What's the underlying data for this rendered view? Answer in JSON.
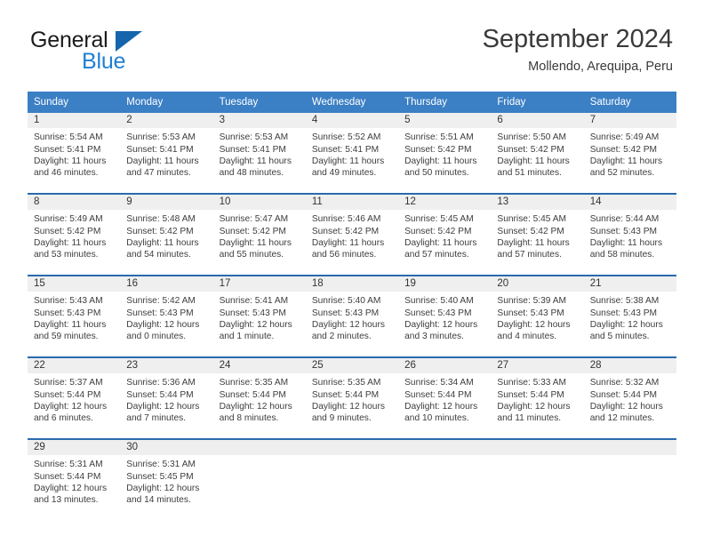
{
  "brand": {
    "name_top": "General",
    "name_bottom": "Blue",
    "triangle_color": "#1565ad",
    "blue_color": "#1f7fd4"
  },
  "header": {
    "title": "September 2024",
    "subtitle": "Mollendo, Arequipa, Peru"
  },
  "theme": {
    "header_bg": "#3b7fc4",
    "week_separator": "#2a6aad",
    "daynum_bg": "#efefef"
  },
  "calendar": {
    "weekdays": [
      "Sunday",
      "Monday",
      "Tuesday",
      "Wednesday",
      "Thursday",
      "Friday",
      "Saturday"
    ],
    "weeks": [
      [
        {
          "day": "1",
          "sunrise": "Sunrise: 5:54 AM",
          "sunset": "Sunset: 5:41 PM",
          "daylight1": "Daylight: 11 hours",
          "daylight2": "and 46 minutes."
        },
        {
          "day": "2",
          "sunrise": "Sunrise: 5:53 AM",
          "sunset": "Sunset: 5:41 PM",
          "daylight1": "Daylight: 11 hours",
          "daylight2": "and 47 minutes."
        },
        {
          "day": "3",
          "sunrise": "Sunrise: 5:53 AM",
          "sunset": "Sunset: 5:41 PM",
          "daylight1": "Daylight: 11 hours",
          "daylight2": "and 48 minutes."
        },
        {
          "day": "4",
          "sunrise": "Sunrise: 5:52 AM",
          "sunset": "Sunset: 5:41 PM",
          "daylight1": "Daylight: 11 hours",
          "daylight2": "and 49 minutes."
        },
        {
          "day": "5",
          "sunrise": "Sunrise: 5:51 AM",
          "sunset": "Sunset: 5:42 PM",
          "daylight1": "Daylight: 11 hours",
          "daylight2": "and 50 minutes."
        },
        {
          "day": "6",
          "sunrise": "Sunrise: 5:50 AM",
          "sunset": "Sunset: 5:42 PM",
          "daylight1": "Daylight: 11 hours",
          "daylight2": "and 51 minutes."
        },
        {
          "day": "7",
          "sunrise": "Sunrise: 5:49 AM",
          "sunset": "Sunset: 5:42 PM",
          "daylight1": "Daylight: 11 hours",
          "daylight2": "and 52 minutes."
        }
      ],
      [
        {
          "day": "8",
          "sunrise": "Sunrise: 5:49 AM",
          "sunset": "Sunset: 5:42 PM",
          "daylight1": "Daylight: 11 hours",
          "daylight2": "and 53 minutes."
        },
        {
          "day": "9",
          "sunrise": "Sunrise: 5:48 AM",
          "sunset": "Sunset: 5:42 PM",
          "daylight1": "Daylight: 11 hours",
          "daylight2": "and 54 minutes."
        },
        {
          "day": "10",
          "sunrise": "Sunrise: 5:47 AM",
          "sunset": "Sunset: 5:42 PM",
          "daylight1": "Daylight: 11 hours",
          "daylight2": "and 55 minutes."
        },
        {
          "day": "11",
          "sunrise": "Sunrise: 5:46 AM",
          "sunset": "Sunset: 5:42 PM",
          "daylight1": "Daylight: 11 hours",
          "daylight2": "and 56 minutes."
        },
        {
          "day": "12",
          "sunrise": "Sunrise: 5:45 AM",
          "sunset": "Sunset: 5:42 PM",
          "daylight1": "Daylight: 11 hours",
          "daylight2": "and 57 minutes."
        },
        {
          "day": "13",
          "sunrise": "Sunrise: 5:45 AM",
          "sunset": "Sunset: 5:42 PM",
          "daylight1": "Daylight: 11 hours",
          "daylight2": "and 57 minutes."
        },
        {
          "day": "14",
          "sunrise": "Sunrise: 5:44 AM",
          "sunset": "Sunset: 5:43 PM",
          "daylight1": "Daylight: 11 hours",
          "daylight2": "and 58 minutes."
        }
      ],
      [
        {
          "day": "15",
          "sunrise": "Sunrise: 5:43 AM",
          "sunset": "Sunset: 5:43 PM",
          "daylight1": "Daylight: 11 hours",
          "daylight2": "and 59 minutes."
        },
        {
          "day": "16",
          "sunrise": "Sunrise: 5:42 AM",
          "sunset": "Sunset: 5:43 PM",
          "daylight1": "Daylight: 12 hours",
          "daylight2": "and 0 minutes."
        },
        {
          "day": "17",
          "sunrise": "Sunrise: 5:41 AM",
          "sunset": "Sunset: 5:43 PM",
          "daylight1": "Daylight: 12 hours",
          "daylight2": "and 1 minute."
        },
        {
          "day": "18",
          "sunrise": "Sunrise: 5:40 AM",
          "sunset": "Sunset: 5:43 PM",
          "daylight1": "Daylight: 12 hours",
          "daylight2": "and 2 minutes."
        },
        {
          "day": "19",
          "sunrise": "Sunrise: 5:40 AM",
          "sunset": "Sunset: 5:43 PM",
          "daylight1": "Daylight: 12 hours",
          "daylight2": "and 3 minutes."
        },
        {
          "day": "20",
          "sunrise": "Sunrise: 5:39 AM",
          "sunset": "Sunset: 5:43 PM",
          "daylight1": "Daylight: 12 hours",
          "daylight2": "and 4 minutes."
        },
        {
          "day": "21",
          "sunrise": "Sunrise: 5:38 AM",
          "sunset": "Sunset: 5:43 PM",
          "daylight1": "Daylight: 12 hours",
          "daylight2": "and 5 minutes."
        }
      ],
      [
        {
          "day": "22",
          "sunrise": "Sunrise: 5:37 AM",
          "sunset": "Sunset: 5:44 PM",
          "daylight1": "Daylight: 12 hours",
          "daylight2": "and 6 minutes."
        },
        {
          "day": "23",
          "sunrise": "Sunrise: 5:36 AM",
          "sunset": "Sunset: 5:44 PM",
          "daylight1": "Daylight: 12 hours",
          "daylight2": "and 7 minutes."
        },
        {
          "day": "24",
          "sunrise": "Sunrise: 5:35 AM",
          "sunset": "Sunset: 5:44 PM",
          "daylight1": "Daylight: 12 hours",
          "daylight2": "and 8 minutes."
        },
        {
          "day": "25",
          "sunrise": "Sunrise: 5:35 AM",
          "sunset": "Sunset: 5:44 PM",
          "daylight1": "Daylight: 12 hours",
          "daylight2": "and 9 minutes."
        },
        {
          "day": "26",
          "sunrise": "Sunrise: 5:34 AM",
          "sunset": "Sunset: 5:44 PM",
          "daylight1": "Daylight: 12 hours",
          "daylight2": "and 10 minutes."
        },
        {
          "day": "27",
          "sunrise": "Sunrise: 5:33 AM",
          "sunset": "Sunset: 5:44 PM",
          "daylight1": "Daylight: 12 hours",
          "daylight2": "and 11 minutes."
        },
        {
          "day": "28",
          "sunrise": "Sunrise: 5:32 AM",
          "sunset": "Sunset: 5:44 PM",
          "daylight1": "Daylight: 12 hours",
          "daylight2": "and 12 minutes."
        }
      ],
      [
        {
          "day": "29",
          "sunrise": "Sunrise: 5:31 AM",
          "sunset": "Sunset: 5:44 PM",
          "daylight1": "Daylight: 12 hours",
          "daylight2": "and 13 minutes."
        },
        {
          "day": "30",
          "sunrise": "Sunrise: 5:31 AM",
          "sunset": "Sunset: 5:45 PM",
          "daylight1": "Daylight: 12 hours",
          "daylight2": "and 14 minutes."
        },
        {
          "day": "",
          "sunrise": "",
          "sunset": "",
          "daylight1": "",
          "daylight2": ""
        },
        {
          "day": "",
          "sunrise": "",
          "sunset": "",
          "daylight1": "",
          "daylight2": ""
        },
        {
          "day": "",
          "sunrise": "",
          "sunset": "",
          "daylight1": "",
          "daylight2": ""
        },
        {
          "day": "",
          "sunrise": "",
          "sunset": "",
          "daylight1": "",
          "daylight2": ""
        },
        {
          "day": "",
          "sunrise": "",
          "sunset": "",
          "daylight1": "",
          "daylight2": ""
        }
      ]
    ]
  }
}
